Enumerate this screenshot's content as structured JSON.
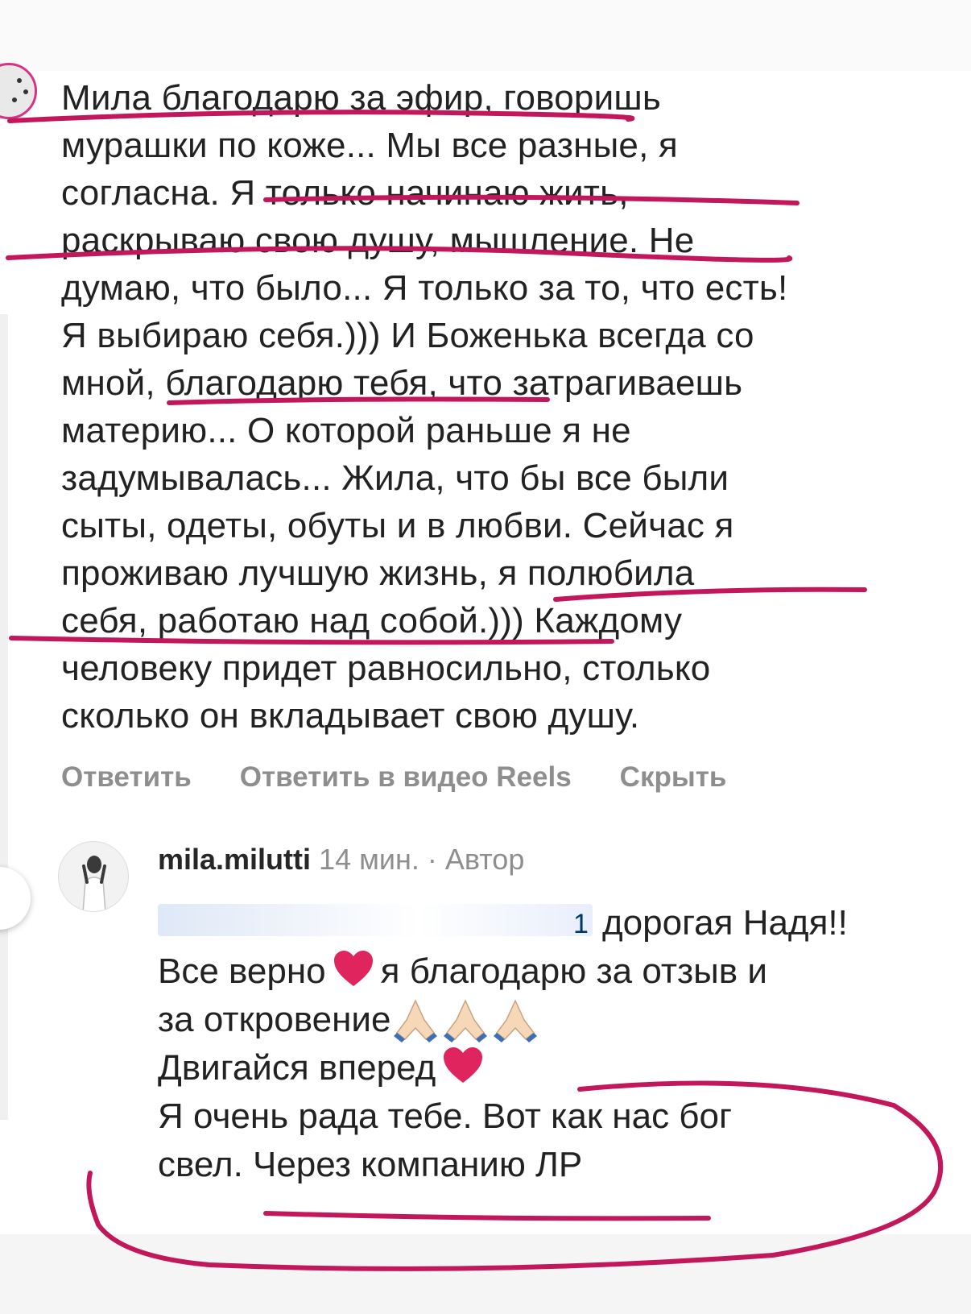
{
  "comment": {
    "lines": [
      "Мила благодарю за эфир, говоришь",
      "мурашки по коже... Мы все разные, я",
      "согласна. Я только начинаю жить,",
      "раскрываю свою душу, мышление. Не",
      "думаю, что было... Я только за то, что есть!",
      "Я выбираю себя.))) И Боженька всегда со",
      "мной, благодарю тебя, что затрагиваешь",
      "материю... О которой раньше я не",
      "задумывалась... Жила, что бы все были",
      "сыты, одеты, обуты и в любви. Сейчас я",
      "проживаю лучшую жизнь, я полюбила",
      "себя, работаю над собой.))) Каждому",
      "человеку придет равносильно, столько",
      "сколько он вкладывает свою душу."
    ]
  },
  "actions": {
    "reply": "Ответить",
    "reply_reels": "Ответить в видео Reels",
    "hide": "Скрыть"
  },
  "reply": {
    "username": "mila.milutti",
    "time": "14 мин.",
    "separator": "·",
    "author_badge": "Автор",
    "mention_partial": "1",
    "line1_text": "дорогая Надя!!",
    "line2_a": "Все верно",
    "line2_b": "я благодарю за отзыв и",
    "line3": "за откровение",
    "line4": "Двигайся вперед",
    "line5": "Я очень рада тебе. Вот как нас бог",
    "line6": "свел. Через компанию ЛР"
  },
  "colors": {
    "annotation": "#c2185b",
    "text": "#222222",
    "muted": "#8e8e8e",
    "story_ring": "#d63384"
  },
  "icons": {
    "heart": "red-heart-emoji",
    "pray": "folded-hands-emoji"
  }
}
